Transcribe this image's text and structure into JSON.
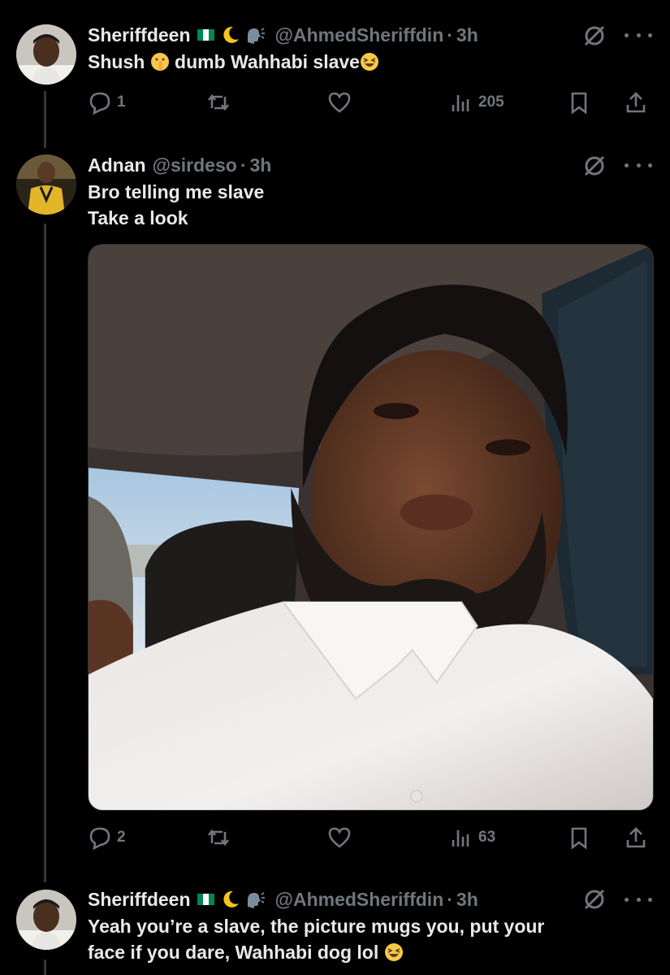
{
  "colors": {
    "background": "#000000",
    "text": "#e7e9ea",
    "muted": "#71767b",
    "thread_line": "#333639"
  },
  "tweets": [
    {
      "name": "Sheriffdeen",
      "handle": "@AhmedSheriffdin",
      "separator": "·",
      "time": "3h",
      "text_parts": [
        "Shush ",
        " dumb Wahhabi slave"
      ],
      "icons": [
        "nigeria-flag",
        "crescent-moon",
        "speaking-head",
        "shushing-face-emoji",
        "laughing-face-emoji"
      ],
      "stats": {
        "replies": "1",
        "views": "205"
      }
    },
    {
      "name": "Adnan",
      "handle": "@sirdeso",
      "separator": "·",
      "time": "3h",
      "text_lines": [
        "Bro telling me slave",
        "Take a look"
      ],
      "media": {
        "type": "photo",
        "subject": "selfie-in-car"
      },
      "stats": {
        "replies": "2",
        "views": "63"
      }
    },
    {
      "name": "Sheriffdeen",
      "handle": "@AhmedSheriffdin",
      "separator": "·",
      "time": "3h",
      "text_lines": [
        "Yeah you’re a slave, the picture mugs you, put your",
        "face if you dare, Wahhabi dog lol "
      ],
      "icons": [
        "nigeria-flag",
        "crescent-moon",
        "speaking-head",
        "laughing-face-emoji"
      ]
    }
  ]
}
